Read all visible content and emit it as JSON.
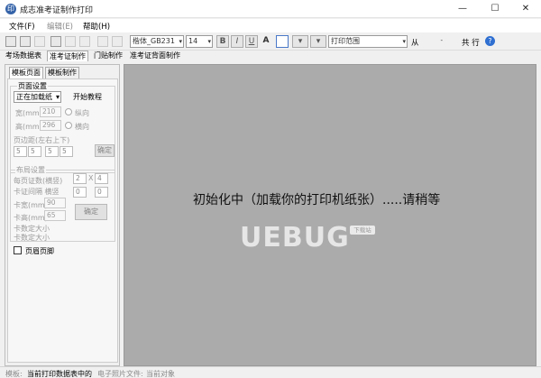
{
  "window": {
    "title": "成志准考证制作打印",
    "app_icon": "app-logo-icon",
    "minimize": "—",
    "maximize": "☐",
    "close": "✕"
  },
  "menu": [
    {
      "label": "文件(F)",
      "enabled": true
    },
    {
      "label": "编辑(E)",
      "enabled": false
    },
    {
      "label": "帮助(H)",
      "enabled": true
    }
  ],
  "toolbar": {
    "font_name": "楷体_GB231",
    "font_size": "14",
    "bold": "B",
    "italic": "I",
    "underline": "U",
    "font_color": "A",
    "print_range": "打印范围",
    "from_label": "从",
    "total_label": "共 行",
    "help": "?"
  },
  "tabs": [
    {
      "label": "考场数据表",
      "active": false
    },
    {
      "label": "准考证制作",
      "active": true
    },
    {
      "label": "门贴制作",
      "active": false
    },
    {
      "label": "准考证背面制作",
      "active": false
    }
  ],
  "left_panel": {
    "subtabs": [
      {
        "label": "模板页面",
        "active": true
      },
      {
        "label": "模板制作",
        "active": false
      }
    ],
    "page_settings": {
      "title": "页面设置",
      "paper_select": "正在加载纸",
      "start_tutorial": "开始教程",
      "width_label": "宽(mm)",
      "width_value": "210",
      "height_label": "高(mm)",
      "height_value": "296",
      "portrait": "纵向",
      "landscape": "横向",
      "margin_label": "页边距(左右上下)",
      "margins": [
        "5",
        "5",
        "5",
        "5"
      ],
      "confirm": "确定"
    },
    "layout_settings": {
      "title": "布局设置",
      "per_page_label": "每页证数(横竖)",
      "card_spacing_label": "卡证间隔 横竖",
      "cols": "2",
      "x": "X",
      "rows": "4",
      "gap_h": "0",
      "gap_v": "0",
      "card_width_label": "卡宽(mm)",
      "card_width": "90",
      "card_height_label": "卡高(mm)",
      "card_height": "65",
      "confirm": "确定",
      "fixed_size_1": "卡数定大小",
      "fixed_size_2": "卡数定大小"
    },
    "header_footer": "页眉页脚"
  },
  "canvas": {
    "message": "初始化中（加载你的打印机纸张）.....请稍等",
    "watermark": "UEBUG",
    "watermark_tag": "下载站"
  },
  "status": {
    "items": [
      "模板:",
      "当前打印数据表中的",
      "电子照片文件:",
      "当前对象"
    ]
  }
}
